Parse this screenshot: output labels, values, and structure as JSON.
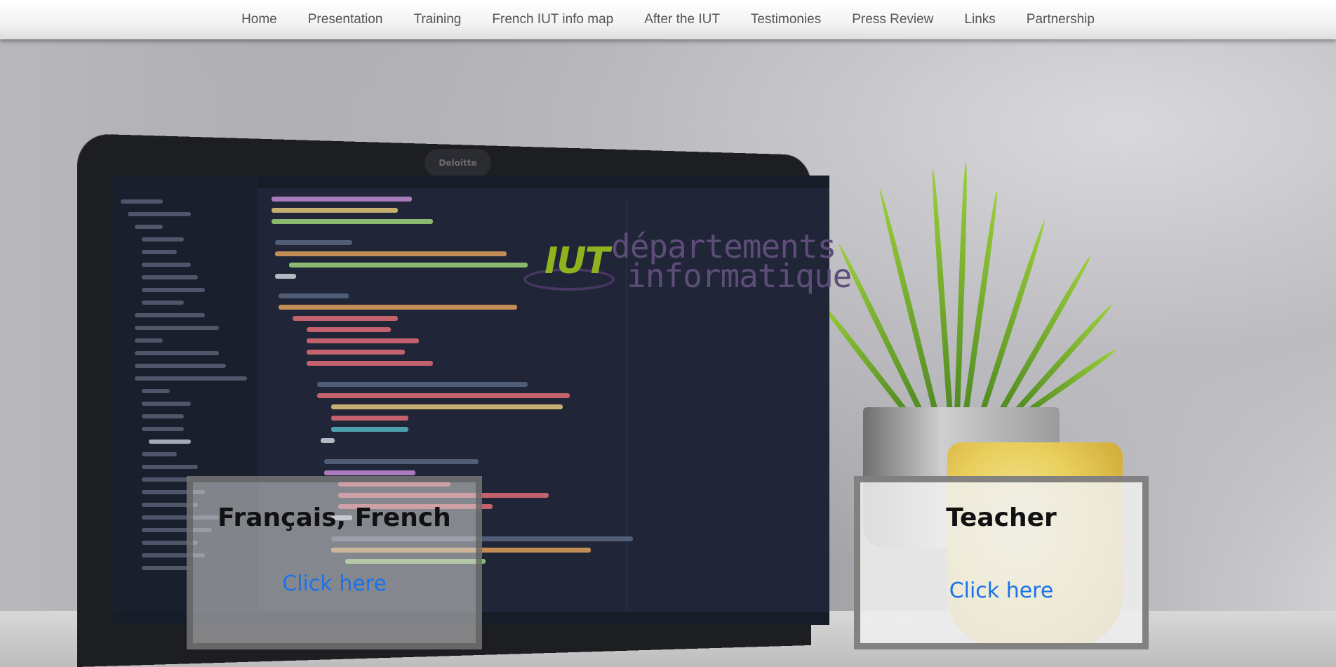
{
  "nav": {
    "items": [
      {
        "label": "Home"
      },
      {
        "label": "Presentation"
      },
      {
        "label": "Training"
      },
      {
        "label": "French IUT info map"
      },
      {
        "label": "After the IUT"
      },
      {
        "label": "Testimonies"
      },
      {
        "label": "Press Review"
      },
      {
        "label": "Links"
      },
      {
        "label": "Partnership"
      }
    ]
  },
  "background": {
    "laptop_brand": "Deloitte",
    "logo": {
      "iut": "IUT",
      "line1": "départements",
      "line2": "informatique"
    }
  },
  "cards": {
    "left": {
      "title": "Français, French",
      "link": "Click here"
    },
    "right": {
      "title": "Teacher",
      "link": "Click here"
    }
  },
  "colors": {
    "link": "#1a73e8",
    "nav_text": "#555555",
    "logo_green": "#8fb21f",
    "logo_purple": "#5d4d78"
  }
}
